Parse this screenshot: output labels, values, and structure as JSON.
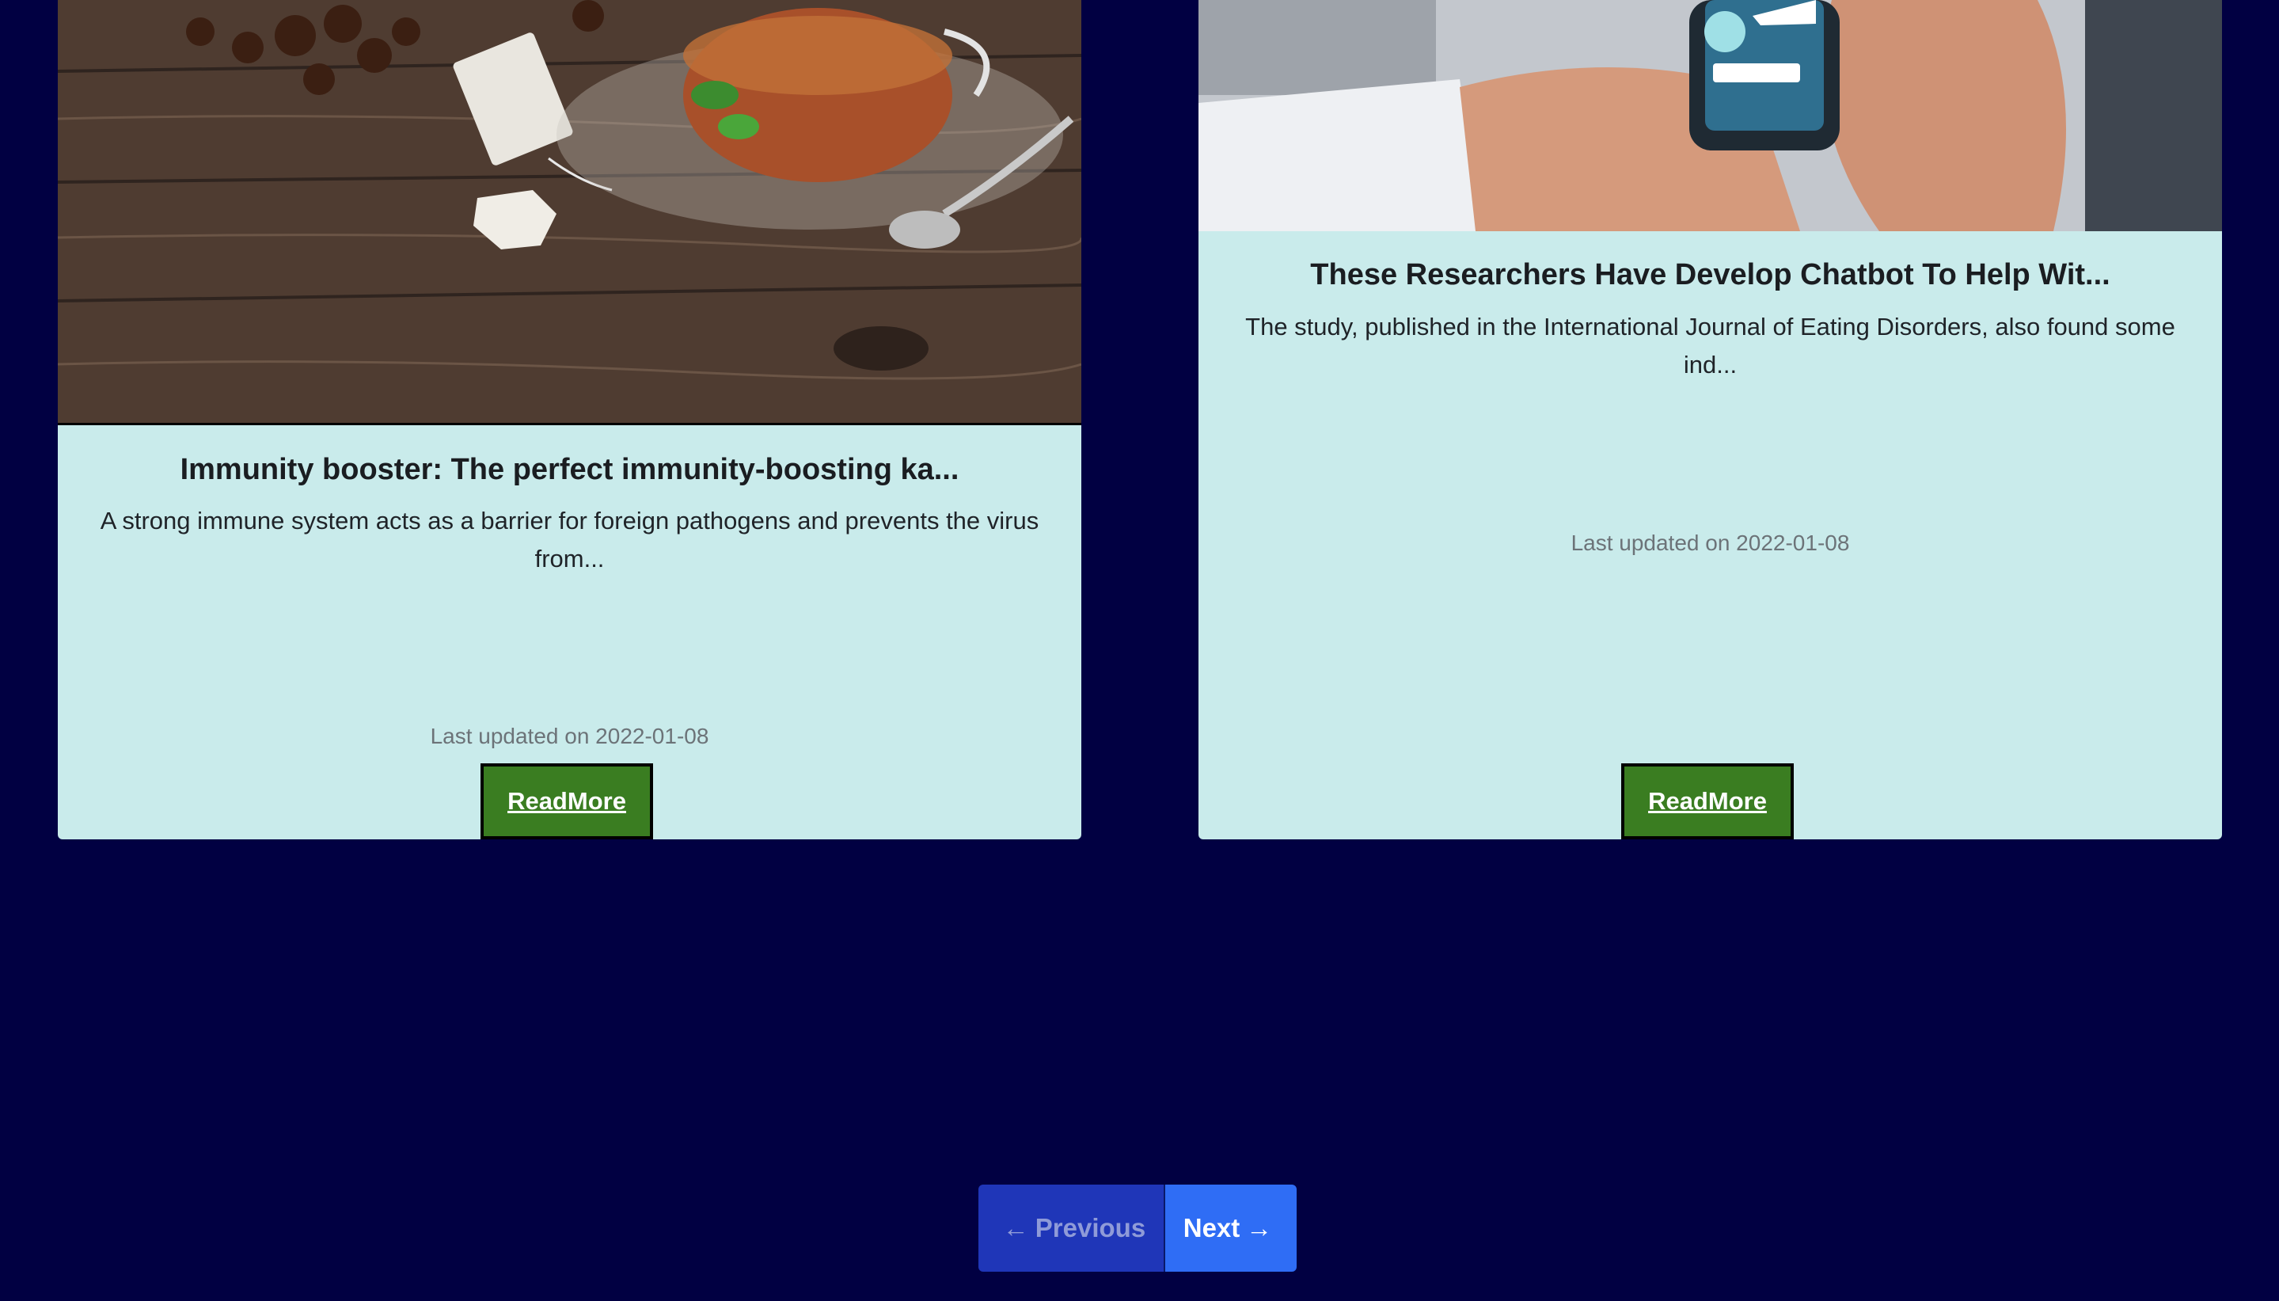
{
  "colors": {
    "page_background": "#010042",
    "card_background": "#c9ebeb",
    "readmore_button": "#3a7d21",
    "pager_prev": "#1f36b8",
    "pager_next": "#2f6df5"
  },
  "cards": [
    {
      "image_subject": "tea cup with tea bag and star anise on wooden table",
      "title": "Immunity booster: The perfect immunity-boosting ka...",
      "description": "A strong immune system acts as a barrier for foreign pathogens and prevents the virus from...",
      "updated": "Last updated on 2022-01-08",
      "button_label": "ReadMore"
    },
    {
      "image_subject": "person holding smartphone with chatbot robot icon",
      "title": "These Researchers Have Develop Chatbot To Help Wit...",
      "description": "The study, published in the International Journal of Eating Disorders, also found some ind...",
      "updated": "Last updated on 2022-01-08",
      "button_label": "ReadMore"
    }
  ],
  "pagination": {
    "prev_icon": "arrow-left-icon",
    "prev_label": "Previous",
    "next_label": "Next",
    "next_icon": "arrow-right-icon"
  }
}
